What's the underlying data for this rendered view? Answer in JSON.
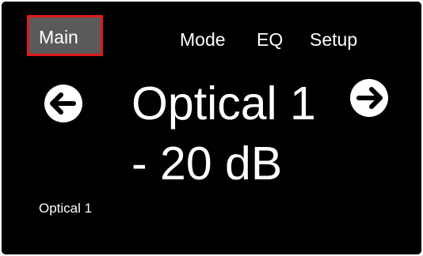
{
  "tabs": {
    "main": "Main",
    "mode": "Mode",
    "eq": "EQ",
    "setup": "Setup",
    "selected": "Main"
  },
  "display": {
    "source": "Optical 1",
    "volume": "- 20 dB",
    "source_label": "Optical 1"
  },
  "icons": {
    "prev": "arrow-left-circle",
    "next": "arrow-right-circle"
  },
  "colors": {
    "background": "#000000",
    "text": "#ffffff",
    "selected_tab_fill": "#5a5a5a",
    "selected_tab_border": "#e01818"
  }
}
